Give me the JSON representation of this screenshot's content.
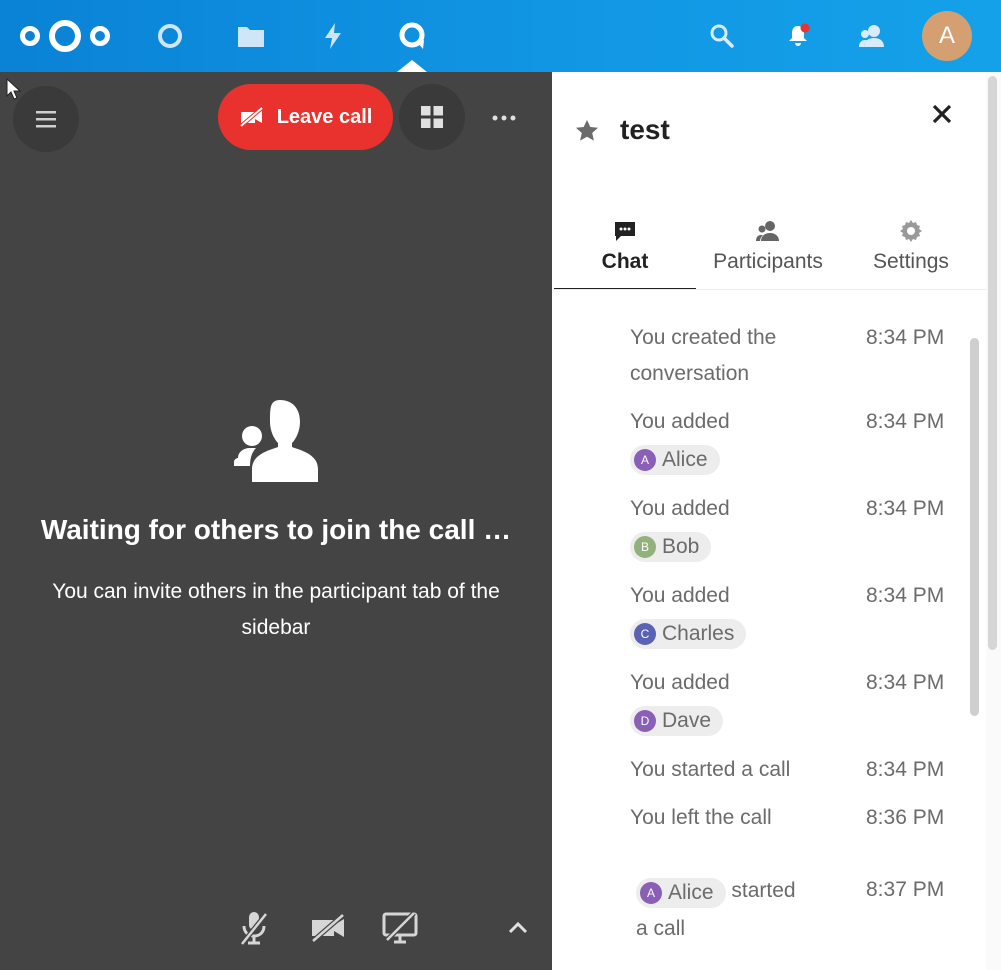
{
  "header": {
    "avatar_initial": "A",
    "apps": [
      "nextcloud-logo",
      "circle-icon",
      "files-icon",
      "activity-icon",
      "talk-icon"
    ],
    "accent": "#0a82d6",
    "notification_dot_color": "#e9322d"
  },
  "call": {
    "leave_label": "Leave call",
    "waiting_title": "Waiting for others to join the call …",
    "waiting_desc": "You can invite others in the participant tab of the sidebar",
    "background": "#444444",
    "leave_color": "#e9322d"
  },
  "sidebar": {
    "title": "test",
    "tabs": [
      {
        "label": "Chat"
      },
      {
        "label": "Participants"
      },
      {
        "label": "Settings"
      }
    ],
    "messages": [
      {
        "text_line1": "You created the",
        "text_line2": "conversation",
        "time": "8:34 PM"
      },
      {
        "text": "You added",
        "mention": {
          "initial": "A",
          "name": "Alice",
          "color": "#8a5fb6"
        },
        "time": "8:34 PM"
      },
      {
        "text": "You added",
        "mention": {
          "initial": "B",
          "name": "Bob",
          "color": "#93b27b"
        },
        "time": "8:34 PM"
      },
      {
        "text": "You added",
        "mention": {
          "initial": "C",
          "name": "Charles",
          "color": "#5b62b5"
        },
        "time": "8:34 PM"
      },
      {
        "text": "You added",
        "mention": {
          "initial": "D",
          "name": "Dave",
          "color": "#8a5fb6"
        },
        "time": "8:34 PM"
      },
      {
        "text": "You started a call",
        "time": "8:34 PM"
      },
      {
        "text": "You left the call",
        "time": "8:36 PM"
      },
      {
        "mention": {
          "initial": "A",
          "name": "Alice",
          "color": "#8a5fb6"
        },
        "text_after": "started",
        "text_line2": "a call",
        "time": "8:37 PM"
      }
    ]
  }
}
